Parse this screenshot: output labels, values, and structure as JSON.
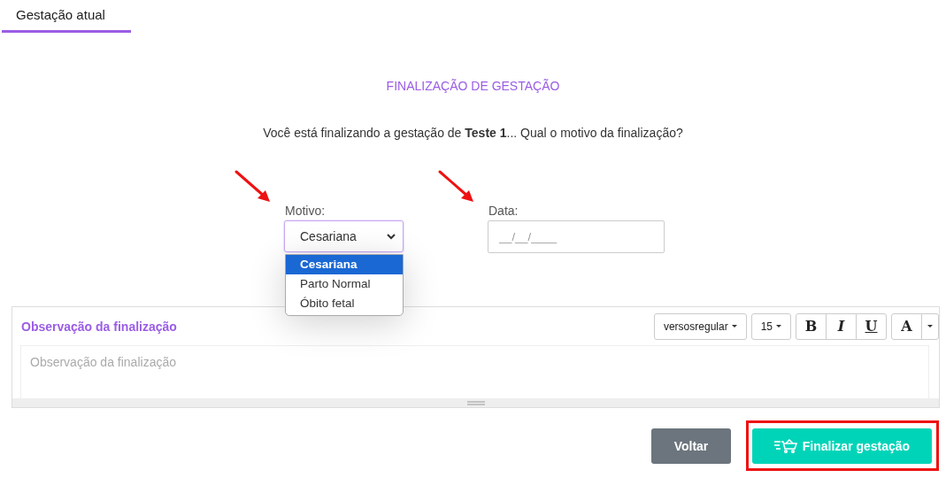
{
  "tabs": [
    {
      "label": "Gestação atual",
      "selected": true
    }
  ],
  "dialog": {
    "title": "FINALIZAÇÃO DE GESTAÇÃO",
    "question": "Você está finalizando a gestação de **Teste 1**... Qual o motivo da finalização?"
  },
  "fields": [
    {
      "kind": "select",
      "label": "Motivo:",
      "value": "Cesariana",
      "arrow": true,
      "expanded": true,
      "options": [
        {
          "label": "Cesariana",
          "selected": true
        },
        {
          "label": "Parto Normal",
          "selected": false
        },
        {
          "label": "Óbito fetal",
          "selected": false
        }
      ]
    },
    {
      "kind": "date",
      "label": "Data:",
      "placeholder": "__/__/____",
      "arrow": true
    }
  ],
  "editor": {
    "title": "Observação da finalização",
    "placeholder": "Observação da finalização",
    "toolbar": [
      {
        "kind": "dropdown",
        "label": "versosregular"
      },
      {
        "kind": "dropdown",
        "label": "15"
      },
      {
        "kind": "bold",
        "label": "B"
      },
      {
        "kind": "italic",
        "label": "I"
      },
      {
        "kind": "underline",
        "label": "U"
      },
      {
        "kind": "color",
        "label": "A"
      }
    ]
  },
  "buttons": [
    {
      "kind": "secondary",
      "label": "Voltar",
      "highlighted": false
    },
    {
      "kind": "primary",
      "label": "Finalizar gestação",
      "highlighted": true
    }
  ]
}
